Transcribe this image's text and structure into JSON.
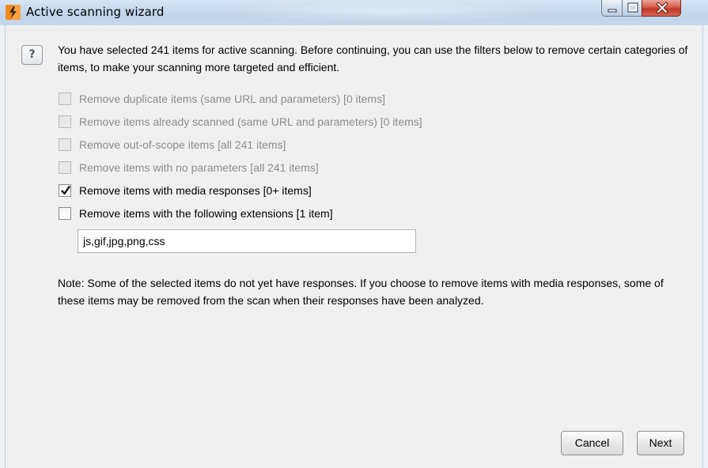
{
  "window": {
    "title": "Active scanning wizard",
    "controls": [
      "minimize-icon",
      "maximize-icon",
      "close-icon"
    ]
  },
  "help_icon": "?",
  "intro_text": "You have selected 241 items for active scanning. Before continuing, you can use the filters below to remove certain categories of items, to make your scanning more targeted and efficient.",
  "options": [
    {
      "label": "Remove duplicate items (same URL and parameters) [0 items]",
      "checked": false,
      "enabled": false
    },
    {
      "label": "Remove items already scanned (same URL and parameters) [0 items]",
      "checked": false,
      "enabled": false
    },
    {
      "label": "Remove out-of-scope items [all 241 items]",
      "checked": false,
      "enabled": false
    },
    {
      "label": "Remove items with no parameters [all 241 items]",
      "checked": false,
      "enabled": false
    },
    {
      "label": "Remove items with media responses [0+ items]",
      "checked": true,
      "enabled": true
    },
    {
      "label": "Remove items with the following extensions [1 item]",
      "checked": false,
      "enabled": true
    }
  ],
  "extensions_value": "js,gif,jpg,png,css",
  "note_text": "Note: Some of the selected items do not yet have responses. If you choose to remove items with media responses, some of these items may be removed from the scan when their responses have been analyzed.",
  "buttons": {
    "cancel": "Cancel",
    "next": "Next"
  },
  "colors": {
    "app_icon": "#f08a1c",
    "close_button": "#c1372a",
    "disabled_text": "#8c8c8c"
  }
}
